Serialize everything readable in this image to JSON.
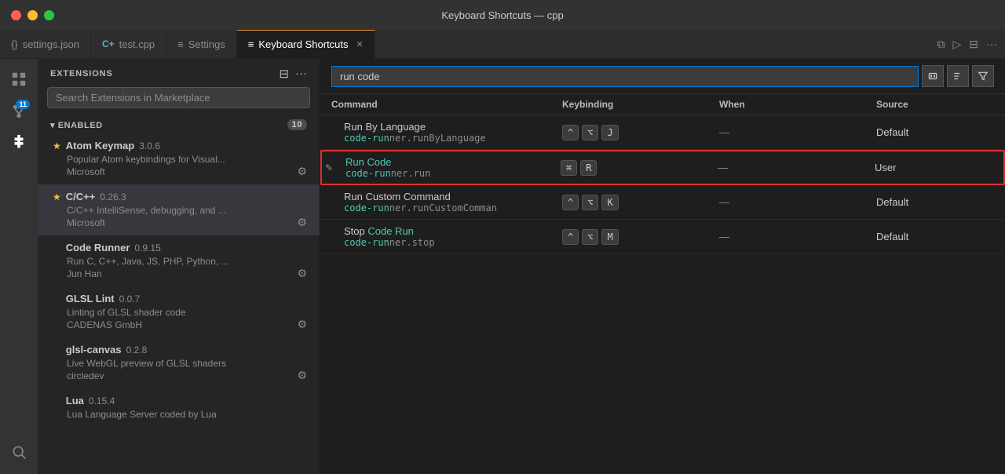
{
  "titlebar": {
    "title": "Keyboard Shortcuts — cpp"
  },
  "tabs": [
    {
      "id": "settings-json",
      "icon": "{}",
      "label": "settings.json",
      "active": false,
      "closable": false
    },
    {
      "id": "test-cpp",
      "icon": "C+",
      "label": "test.cpp",
      "active": false,
      "closable": false
    },
    {
      "id": "settings",
      "icon": "≡",
      "label": "Settings",
      "active": false,
      "closable": false
    },
    {
      "id": "keyboard-shortcuts",
      "icon": "≡",
      "label": "Keyboard Shortcuts",
      "active": true,
      "closable": true
    }
  ],
  "activitybar": {
    "icons": [
      {
        "id": "explorer",
        "symbol": "⎘",
        "active": false
      },
      {
        "id": "source-control",
        "symbol": "⎇",
        "active": false,
        "badge": "11"
      },
      {
        "id": "extensions",
        "symbol": "⊞",
        "active": true
      },
      {
        "id": "search",
        "symbol": "🔍",
        "active": false
      }
    ]
  },
  "sidebar": {
    "title": "EXTENSIONS",
    "search_placeholder": "Search Extensions in Marketplace",
    "section": {
      "label": "ENABLED",
      "count": "10"
    },
    "extensions": [
      {
        "id": "atom-keymap",
        "star": true,
        "name": "Atom Keymap",
        "version": "3.0.6",
        "description": "Popular Atom keybindings for Visual...",
        "publisher": "Microsoft",
        "selected": false
      },
      {
        "id": "cpp",
        "star": true,
        "name": "C/C++",
        "version": "0.26.3",
        "description": "C/C++ IntelliSense, debugging, and ...",
        "publisher": "Microsoft",
        "selected": true
      },
      {
        "id": "code-runner",
        "star": false,
        "name": "Code Runner",
        "version": "0.9.15",
        "description": "Run C, C++, Java, JS, PHP, Python, ...",
        "publisher": "Jun Han",
        "selected": false
      },
      {
        "id": "glsl-lint",
        "star": false,
        "name": "GLSL Lint",
        "version": "0.0.7",
        "description": "Linting of GLSL shader code",
        "publisher": "CADENAS GmbH",
        "selected": false
      },
      {
        "id": "glsl-canvas",
        "star": false,
        "name": "glsl-canvas",
        "version": "0.2.8",
        "description": "Live WebGL preview of GLSL shaders",
        "publisher": "circledev",
        "selected": false
      },
      {
        "id": "lua",
        "star": false,
        "name": "Lua",
        "version": "0.15.4",
        "description": "Lua Language Server coded by Lua",
        "publisher": "",
        "selected": false
      }
    ]
  },
  "keyboard_shortcuts": {
    "search_value": "run code",
    "table_headers": {
      "command": "Command",
      "keybinding": "Keybinding",
      "when": "When",
      "source": "Source"
    },
    "rows": [
      {
        "id": "run-by-language",
        "command_name": "Run By Language",
        "command_id": "code-runner.runByLanguage",
        "command_id_highlight": null,
        "keybinding": [
          "^",
          "⌥",
          "J"
        ],
        "when": "—",
        "source": "Default",
        "highlighted": false,
        "edit_icon": false
      },
      {
        "id": "run-code",
        "command_name": "Run Code",
        "command_id": "code-runner.run",
        "command_id_parts": [
          "code-run",
          "ner.run"
        ],
        "keybinding": [
          "⌘",
          "R"
        ],
        "when": "—",
        "source": "User",
        "highlighted": true,
        "edit_icon": true
      },
      {
        "id": "run-custom-command",
        "command_name": "Run Custom Command",
        "command_id": "code-runner.runCustomComman",
        "keybinding": [
          "^",
          "⌥",
          "K"
        ],
        "when": "—",
        "source": "Default",
        "highlighted": false,
        "edit_icon": false
      },
      {
        "id": "stop-code-run",
        "command_name": "Stop Code Run",
        "command_id": "code-runner.stop",
        "command_id_parts": [
          "code-run",
          "ner.stop"
        ],
        "keybinding": [
          "^",
          "⌥",
          "M"
        ],
        "when": "—",
        "source": "Default",
        "highlighted": false,
        "edit_icon": false
      }
    ]
  },
  "colors": {
    "accent": "#0078d4",
    "highlight_border": "#e03030",
    "user_color": "#4ec9b0",
    "teal": "#4ec9b0"
  }
}
